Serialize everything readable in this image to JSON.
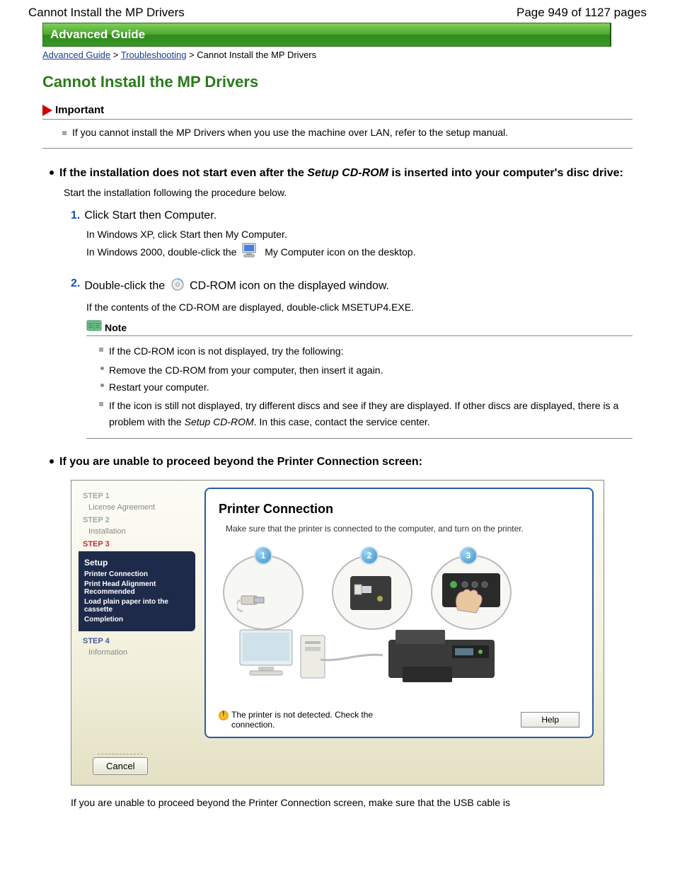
{
  "header": {
    "left": "Cannot Install the MP Drivers",
    "right": "Page 949 of 1127 pages"
  },
  "adv_guide_bar": "Advanced Guide",
  "breadcrumb": {
    "l1": "Advanced Guide",
    "sep1": " > ",
    "l2": "Troubleshooting",
    "sep2": " > ",
    "l3": "Cannot Install the MP Drivers"
  },
  "main_title": "Cannot Install the MP Drivers",
  "important": {
    "label": "Important",
    "line": "If you cannot install the MP Drivers when you use the machine over LAN, refer to the setup manual."
  },
  "sec1": {
    "title_a": "If the installation does not start even after the ",
    "title_em": "Setup CD-ROM",
    "title_b": " is inserted into your computer's disc drive:",
    "intro": "Start the installation following the procedure below.",
    "step1": {
      "num": "1.",
      "title": "Click Start then Computer.",
      "l1": "In Windows XP, click Start then My Computer.",
      "l2a": "In Windows 2000, double-click the ",
      "l2b": " My Computer icon on the desktop."
    },
    "step2": {
      "num": "2.",
      "title_a": "Double-click the ",
      "title_b": " CD-ROM icon on the displayed window.",
      "l1": "If the contents of the CD-ROM are displayed, double-click MSETUP4.EXE."
    },
    "note": {
      "label": "Note",
      "n1": "If the CD-ROM icon is not displayed, try the following:",
      "n1a": "Remove the CD-ROM from your computer, then insert it again.",
      "n1b": "Restart your computer.",
      "n2a": "If the icon is still not displayed, try different discs and see if they are displayed. If other discs are displayed, there is a problem with the ",
      "n2em": "Setup CD-ROM",
      "n2b": ". In this case, contact the service center."
    }
  },
  "sec2": {
    "title": "If you are unable to proceed beyond the Printer Connection screen:"
  },
  "wizard": {
    "step1": "STEP 1",
    "step1a": "License Agreement",
    "step2": "STEP 2",
    "step2a": "Installation",
    "step3": "STEP 3",
    "setup": "Setup",
    "s_a": "Printer Connection",
    "s_b": "Print Head Alignment Recommended",
    "s_c": "Load plain paper into the cassette",
    "s_d": "Completion",
    "step4": "STEP 4",
    "step4a": "Information",
    "main_title": "Printer Connection",
    "main_txt": "Make sure that the printer is connected to the computer, and turn on the printer.",
    "c1": "1",
    "c2": "2",
    "c3": "3",
    "status": "The printer is not detected. Check the connection.",
    "help": "Help",
    "cancel": "Cancel"
  },
  "trailing": "If you are unable to proceed beyond the Printer Connection screen, make sure that the USB cable is"
}
